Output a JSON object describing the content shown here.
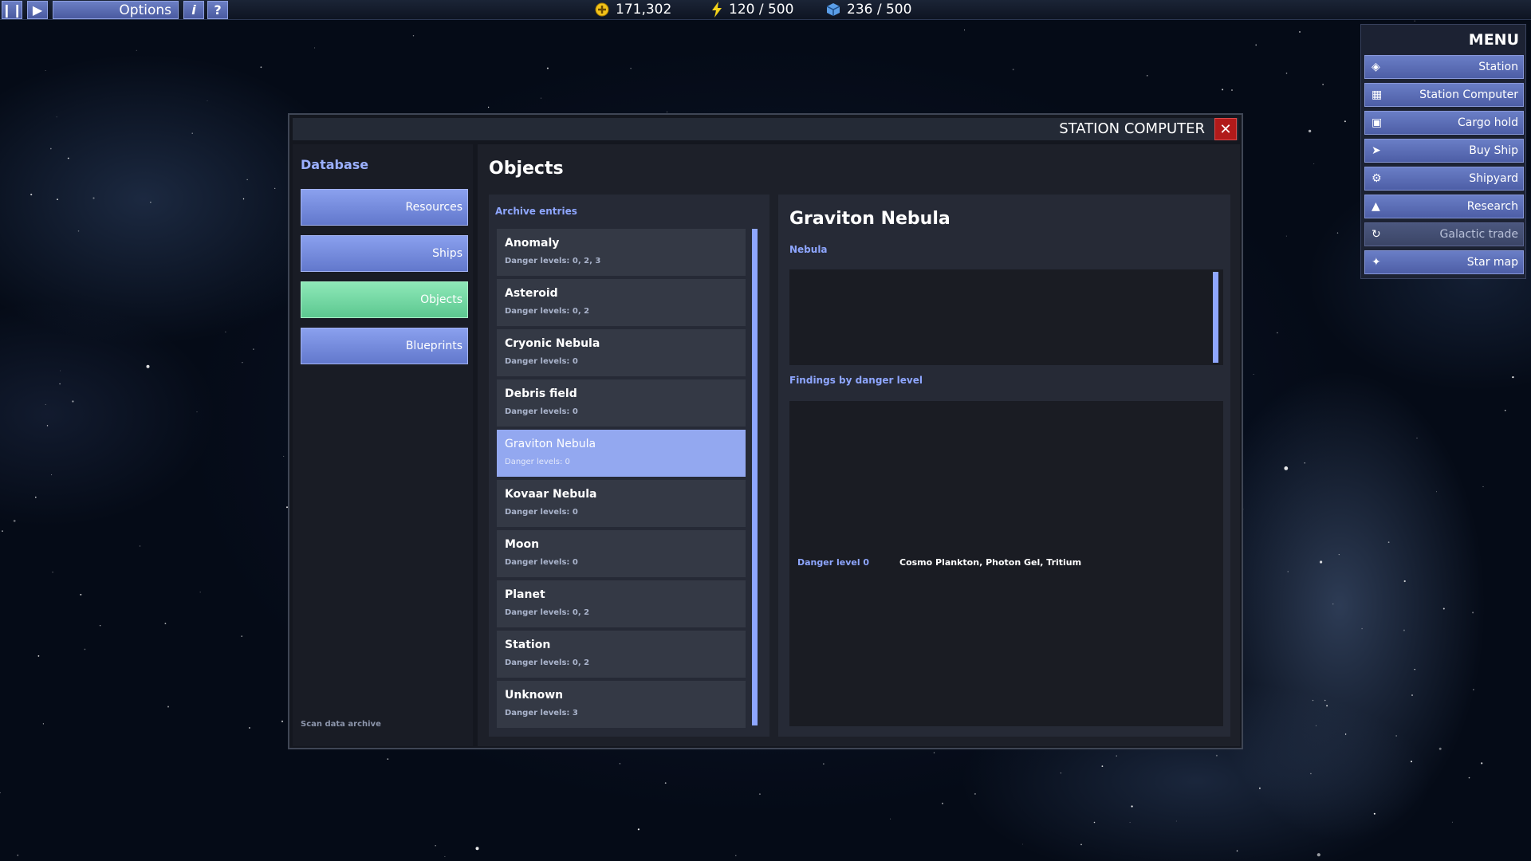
{
  "topbar": {
    "options_label": "Options",
    "info_icon": "info-icon",
    "help_icon": "help-icon",
    "credits": "171,302",
    "energy": "120 / 500",
    "cargo": "236 / 500"
  },
  "menu": {
    "title": "MENU",
    "items": [
      {
        "label": "Station",
        "icon": "diamond-icon"
      },
      {
        "label": "Station Computer",
        "icon": "grid-icon"
      },
      {
        "label": "Cargo hold",
        "icon": "box-icon"
      },
      {
        "label": "Buy Ship",
        "icon": "rocket-icon"
      },
      {
        "label": "Shipyard",
        "icon": "gear-icon"
      },
      {
        "label": "Research",
        "icon": "flask-icon"
      },
      {
        "label": "Galactic trade",
        "icon": "refresh-icon"
      },
      {
        "label": "Star map",
        "icon": "stars-icon"
      }
    ]
  },
  "window": {
    "title": "STATION COMPUTER",
    "close_icon": "close-icon"
  },
  "sidebar": {
    "title": "Database",
    "buttons": [
      "Resources",
      "Ships",
      "Objects",
      "Blueprints"
    ],
    "active": "Objects",
    "footer": "Scan data archive"
  },
  "content": {
    "title": "Objects",
    "archive_label": "Archive entries",
    "entries": [
      {
        "name": "Anomaly",
        "sub": "Danger levels: 0, 2, 3"
      },
      {
        "name": "Asteroid",
        "sub": "Danger levels: 0, 2"
      },
      {
        "name": "Cryonic Nebula",
        "sub": "Danger levels: 0"
      },
      {
        "name": "Debris field",
        "sub": "Danger levels: 0"
      },
      {
        "name": "Graviton Nebula",
        "sub": "Danger levels: 0"
      },
      {
        "name": "Kovaar Nebula",
        "sub": "Danger levels: 0"
      },
      {
        "name": "Moon",
        "sub": "Danger levels: 0"
      },
      {
        "name": "Planet",
        "sub": "Danger levels: 0, 2"
      },
      {
        "name": "Station",
        "sub": "Danger levels: 0, 2"
      },
      {
        "name": "Unknown",
        "sub": "Danger levels: 3"
      }
    ],
    "selected": "Graviton Nebula"
  },
  "detail": {
    "title": "Graviton Nebula",
    "type": "Nebula",
    "findings_label": "Findings by danger level",
    "findings": [
      {
        "level": "Danger level 0",
        "items": "Cosmo Plankton, Photon Gel, Tritium"
      }
    ]
  }
}
